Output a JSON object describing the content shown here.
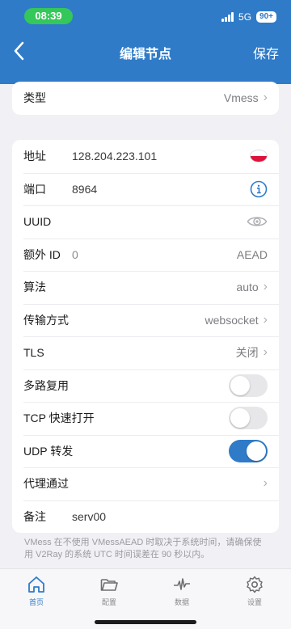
{
  "status": {
    "time": "08:39",
    "network": "5G",
    "battery": "90+"
  },
  "header": {
    "title": "编辑节点",
    "save": "保存"
  },
  "type_row": {
    "label": "类型",
    "value": "Vmess"
  },
  "fields": {
    "address": {
      "label": "地址",
      "value": "128.204.223.101"
    },
    "port": {
      "label": "端口",
      "value": "8964"
    },
    "uuid": {
      "label": "UUID"
    },
    "extra_id": {
      "label": "额外 ID",
      "value": "0",
      "badge": "AEAD"
    },
    "algorithm": {
      "label": "算法",
      "value": "auto"
    },
    "transport": {
      "label": "传输方式",
      "value": "websocket"
    },
    "tls": {
      "label": "TLS",
      "value": "关闭"
    },
    "mux": {
      "label": "多路复用",
      "on": false
    },
    "tcp_fast_open": {
      "label": "TCP 快速打开",
      "on": false
    },
    "udp_forward": {
      "label": "UDP 转发",
      "on": true
    },
    "proxy_via": {
      "label": "代理通过"
    },
    "remark": {
      "label": "备注",
      "value": "serv00"
    }
  },
  "note": "VMess 在不使用 VMessAEAD 时取决于系统时间，请确保使用 V2Ray 的系统 UTC 时间误差在 90 秒以内。",
  "tabs": [
    {
      "label": "首页",
      "icon": "home-icon",
      "active": true
    },
    {
      "label": "配置",
      "icon": "folder-icon",
      "active": false
    },
    {
      "label": "数据",
      "icon": "pulse-icon",
      "active": false
    },
    {
      "label": "设置",
      "icon": "gear-icon",
      "active": false
    }
  ],
  "colors": {
    "accent": "#2f7bc8",
    "status_time_bg": "#34c759",
    "flag_red": "#dc143c"
  }
}
